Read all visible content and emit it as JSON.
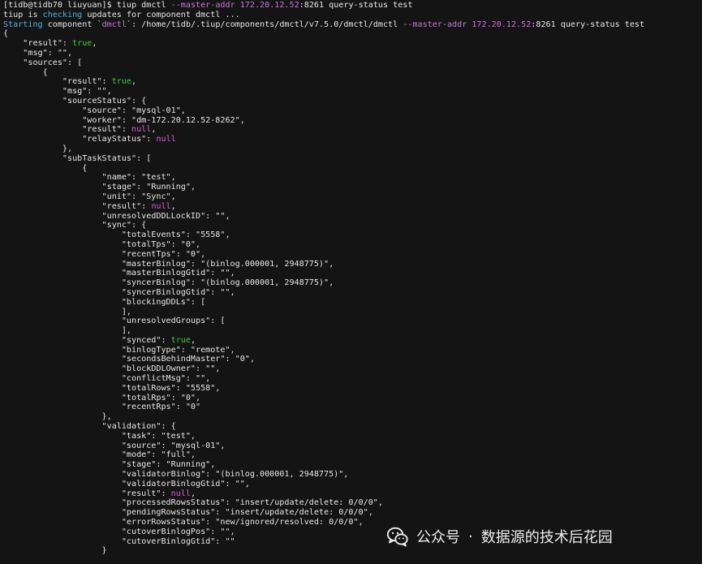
{
  "terminal": {
    "prompt": "[tidb@tidb70 liuyuan]$ ",
    "cmd_name": "tiup dmctl ",
    "flag": "--master-addr",
    "addr_ip": "172.20.12.52",
    "cmd_rest": ":8261 query-status test",
    "check_pre": "tiup is ",
    "check_word": "checking",
    "check_post": " updates for component dmctl ...",
    "start_word": "Starting",
    "start_mid": " component `",
    "start_comp": "dmctl",
    "start_path": "`: /home/tidb/.tiup/components/dmctl/v7.5.0/dmctl/dmctl ",
    "start_flag": "--master-addr",
    "start_sp": " ",
    "start_ip": "172.20.12.52",
    "start_rest": ":8261 query-status test",
    "json_lines": [
      "{",
      "    \"result\": ",
      "true",
      ",",
      "    \"msg\": \"\",",
      "    \"sources\": [",
      "        {",
      "            \"result\": ",
      "true",
      ",",
      "            \"msg\": \"\",",
      "            \"sourceStatus\": {",
      "                \"source\": \"mysql-01\",",
      "                \"worker\": \"dm-172.20.12.52-8262\",",
      "                \"result\": ",
      "null",
      ",",
      "                \"relayStatus\": ",
      "null",
      "            },",
      "            \"subTaskStatus\": [",
      "                {",
      "                    \"name\": \"test\",",
      "                    \"stage\": \"Running\",",
      "                    \"unit\": \"Sync\",",
      "                    \"result\": ",
      "null",
      ",",
      "                    \"unresolvedDDLLockID\": \"\",",
      "                    \"sync\": {",
      "                        \"totalEvents\": \"5558\",",
      "                        \"totalTps\": \"0\",",
      "                        \"recentTps\": \"0\",",
      "                        \"masterBinlog\": \"(binlog.000001, 2948775)\",",
      "                        \"masterBinlogGtid\": \"\",",
      "                        \"syncerBinlog\": \"(binlog.000001, 2948775)\",",
      "                        \"syncerBinlogGtid\": \"\",",
      "                        \"blockingDDLs\": [",
      "                        ],",
      "                        \"unresolvedGroups\": [",
      "                        ],",
      "                        \"synced\": ",
      "true",
      ",",
      "                        \"binlogType\": \"remote\",",
      "                        \"secondsBehindMaster\": \"0\",",
      "                        \"blockDDLOwner\": \"\",",
      "                        \"conflictMsg\": \"\",",
      "                        \"totalRows\": \"5558\",",
      "                        \"totalRps\": \"0\",",
      "                        \"recentRps\": \"0\"",
      "                    },",
      "                    \"validation\": {",
      "                        \"task\": \"test\",",
      "                        \"source\": \"mysql-01\",",
      "                        \"mode\": \"full\",",
      "                        \"stage\": \"Running\",",
      "                        \"validatorBinlog\": \"(binlog.000001, 2948775)\",",
      "                        \"validatorBinlogGtid\": \"\",",
      "                        \"result\": ",
      "null",
      ",",
      "                        \"processedRowsStatus\": \"insert/update/delete: 0/0/0\",",
      "                        \"pendingRowsStatus\": \"insert/update/delete: 0/0/0\",",
      "                        \"errorRowsStatus\": \"new/ignored/resolved: 0/0/0\",",
      "                        \"cutoverBinlogPos\": \"\",",
      "                        \"cutoverBinlogGtid\": \"\"",
      "                    }"
    ]
  },
  "watermark": {
    "channel": "公众号",
    "sep": "·",
    "name": "数据源的技术后花园",
    "icon": "wechat-icon"
  },
  "colors": {
    "background": "#141414",
    "text": "#e6e6e6",
    "flag": "#c678dd",
    "info": "#4fb3e8",
    "bool": "#3fc93f",
    "null": "#d45fd4"
  }
}
